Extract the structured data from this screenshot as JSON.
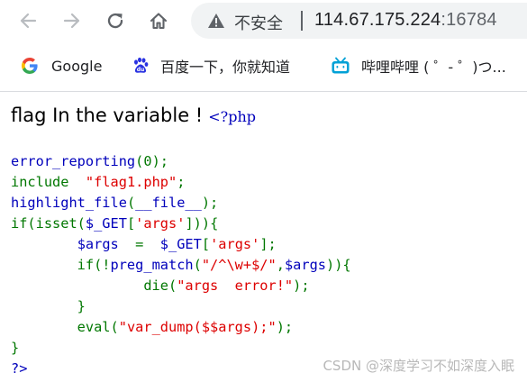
{
  "browser": {
    "security_label": "不安全",
    "url_host": "114.67.175.224",
    "url_port": ":16784",
    "bookmarks": [
      {
        "label": "Google",
        "icon": "google-icon"
      },
      {
        "label": "百度一下，你就知道",
        "icon": "baidu-paw-icon"
      },
      {
        "label": "哔哩哔哩 ( ゜- ゜)つ...",
        "icon": "bilibili-tv-icon"
      }
    ]
  },
  "page": {
    "heading": "flag In the variable !",
    "php_open": "<?php",
    "code_lines": [
      [
        {
          "t": "fn",
          "v": "error_reporting"
        },
        {
          "t": "kw",
          "v": "(0);"
        }
      ],
      [
        {
          "t": "kw",
          "v": "include  "
        },
        {
          "t": "str",
          "v": "\"flag1.php\""
        },
        {
          "t": "kw",
          "v": ";"
        }
      ],
      [
        {
          "t": "fn",
          "v": "highlight_file"
        },
        {
          "t": "kw",
          "v": "("
        },
        {
          "t": "fn",
          "v": "__file__"
        },
        {
          "t": "kw",
          "v": ");"
        }
      ],
      [
        {
          "t": "kw",
          "v": "if(isset("
        },
        {
          "t": "var",
          "v": "$_GET"
        },
        {
          "t": "kw",
          "v": "["
        },
        {
          "t": "str",
          "v": "'args'"
        },
        {
          "t": "kw",
          "v": "])){"
        }
      ],
      [
        {
          "t": "kw",
          "v": "        "
        },
        {
          "t": "var",
          "v": "$args  "
        },
        {
          "t": "kw",
          "v": "=  "
        },
        {
          "t": "var",
          "v": "$_GET"
        },
        {
          "t": "kw",
          "v": "["
        },
        {
          "t": "str",
          "v": "'args'"
        },
        {
          "t": "kw",
          "v": "];"
        }
      ],
      [
        {
          "t": "kw",
          "v": "        if(!"
        },
        {
          "t": "fn",
          "v": "preg_match"
        },
        {
          "t": "kw",
          "v": "("
        },
        {
          "t": "str",
          "v": "\"/^\\w+$/\""
        },
        {
          "t": "kw",
          "v": ","
        },
        {
          "t": "var",
          "v": "$args"
        },
        {
          "t": "kw",
          "v": ")){"
        }
      ],
      [
        {
          "t": "kw",
          "v": "                die("
        },
        {
          "t": "str",
          "v": "\"args  error!\""
        },
        {
          "t": "kw",
          "v": ");"
        }
      ],
      [
        {
          "t": "kw",
          "v": "        }"
        }
      ],
      [
        {
          "t": "kw",
          "v": "        eval("
        },
        {
          "t": "str",
          "v": "\"var_dump($$args);\""
        },
        {
          "t": "kw",
          "v": ");"
        }
      ],
      [
        {
          "t": "kw",
          "v": "}"
        }
      ],
      [
        {
          "t": "fn",
          "v": "?>"
        }
      ]
    ],
    "watermark": "CSDN @深度学习不如深度入眠"
  },
  "colors": {
    "php_keyword": "#007700",
    "php_default": "#0000bb",
    "php_string": "#dd0000"
  }
}
